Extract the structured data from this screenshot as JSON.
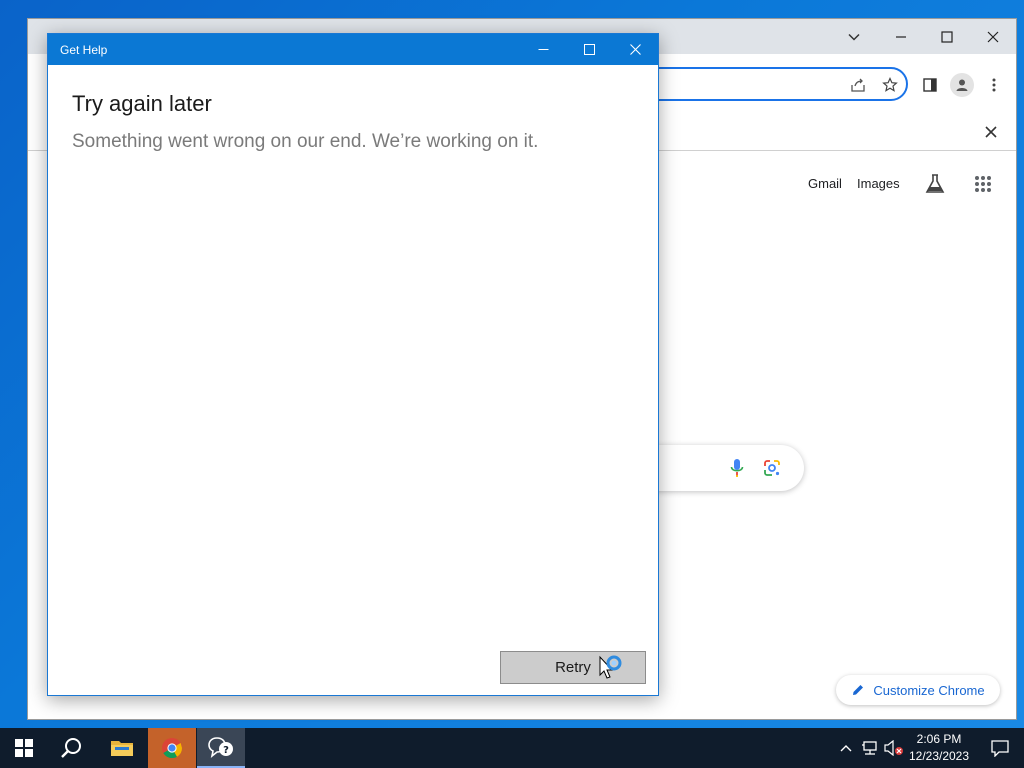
{
  "chrome": {
    "links": {
      "gmail": "Gmail",
      "images": "Images"
    },
    "customize_label": "Customize Chrome",
    "icons": [
      "chevron-down-icon",
      "minimize-icon",
      "maximize-icon",
      "close-icon",
      "share-icon",
      "star-icon",
      "side-panel-icon",
      "profile-icon",
      "more-vert-icon",
      "labs-flask-icon",
      "apps-grid-icon",
      "mic-icon",
      "lens-icon",
      "pencil-icon"
    ]
  },
  "get_help": {
    "title": "Get Help",
    "heading": "Try again later",
    "message": "Something went wrong on our end. We’re working on it.",
    "retry_label": "Retry"
  },
  "taskbar": {
    "time": "2:06 PM",
    "date": "12/23/2023",
    "apps": [
      "start",
      "search",
      "file-explorer",
      "chrome",
      "get-help"
    ]
  },
  "colors": {
    "titlebar": "#0b78d4",
    "omnibox_focus": "#1a73e8",
    "taskbar": "#0f1c2c",
    "chrome_active_tab": "#c4622a"
  }
}
